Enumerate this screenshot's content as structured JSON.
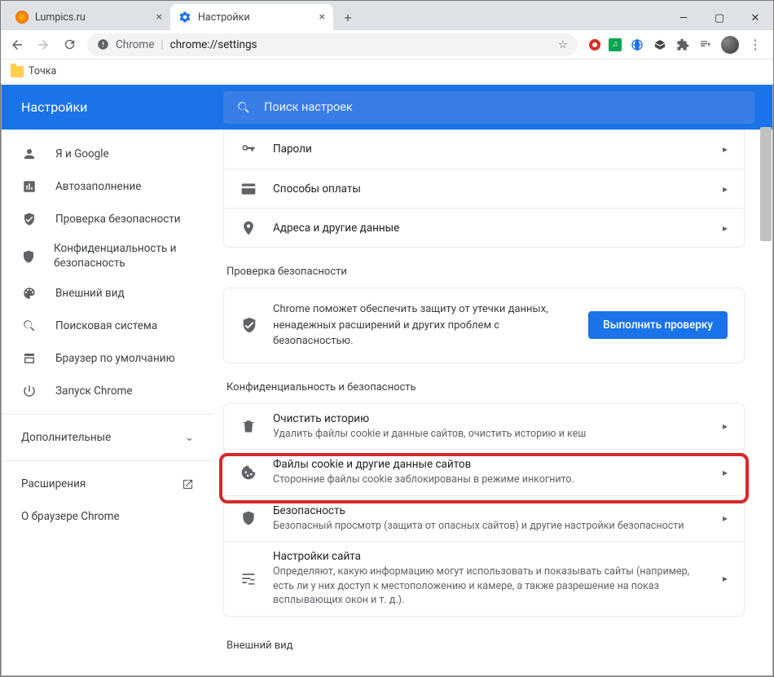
{
  "window": {
    "tabs": [
      {
        "title": "Lumpics.ru",
        "active": false
      },
      {
        "title": "Настройки",
        "active": true
      }
    ]
  },
  "toolbar": {
    "secure_label": "Chrome",
    "url": "chrome://settings"
  },
  "bookmarks": {
    "item0": "Точка"
  },
  "header": {
    "title": "Настройки",
    "search_placeholder": "Поиск настроек"
  },
  "sidebar": {
    "items": [
      "Я и Google",
      "Автозаполнение",
      "Проверка безопасности",
      "Конфиденциальность и безопасность",
      "Внешний вид",
      "Поисковая система",
      "Браузер по умолчанию",
      "Запуск Chrome"
    ],
    "advanced": "Дополнительные",
    "extensions": "Расширения",
    "about": "О браузере Chrome"
  },
  "autofill": {
    "passwords": "Пароли",
    "payment": "Способы оплаты",
    "addresses": "Адреса и другие данные"
  },
  "safety": {
    "heading": "Проверка безопасности",
    "desc": "Chrome поможет обеспечить защиту от утечки данных, ненадежных расширений и других проблем с безопасностью.",
    "button": "Выполнить проверку"
  },
  "privacy": {
    "heading": "Конфиденциальность и безопасность",
    "clear_title": "Очистить историю",
    "clear_sub": "Удалить файлы cookie и данные сайтов, очистить историю и кеш",
    "cookies_title": "Файлы cookie и другие данные сайтов",
    "cookies_sub": "Сторонние файлы cookie заблокированы в режиме инкогнито.",
    "security_title": "Безопасность",
    "security_sub": "Безопасный просмотр (защита от опасных сайтов) и другие настройки безопасности",
    "site_title": "Настройки сайта",
    "site_sub": "Определяют, какую информацию могут использовать и показывать сайты (например, есть ли у них доступ к местоположению и камере, а также разрешение на показ всплывающих окон и т. д.)."
  },
  "appearance": {
    "heading": "Внешний вид"
  }
}
